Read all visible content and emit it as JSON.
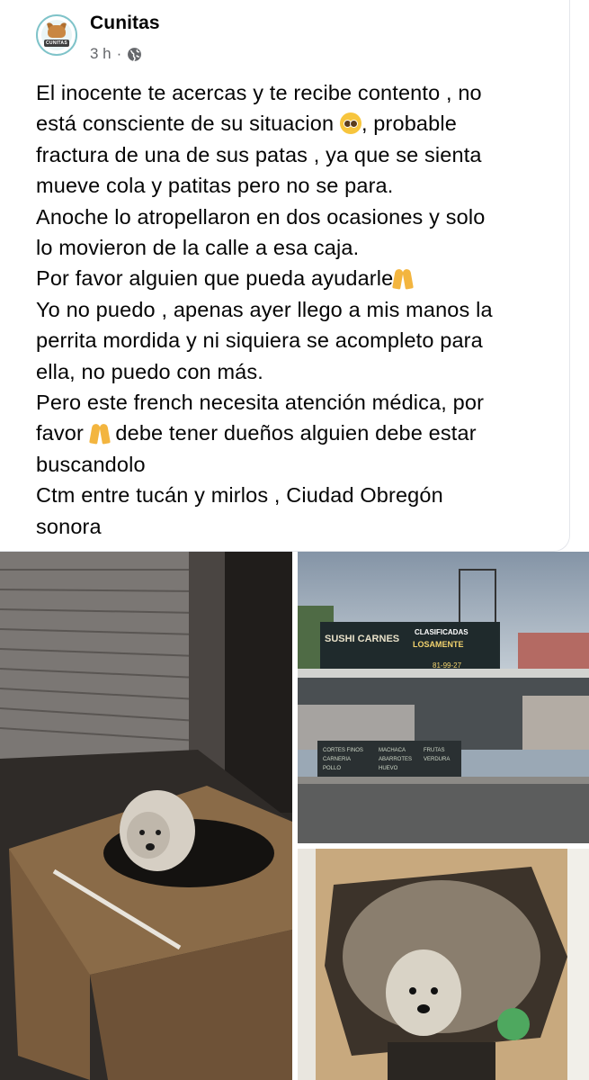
{
  "post": {
    "page_name": "Cunitas",
    "time": "3 h",
    "separator": "·",
    "avatar_text": "CUNITAS",
    "lines": [
      "El inocente te acercas y te recibe contento , no",
      "está consciente de su situacion",
      ", probable",
      "fractura de una de sus patas , ya que se sienta",
      "mueve cola y patitas pero no se para.",
      "Anoche lo atropellaron en dos ocasiones y solo",
      "lo movieron de la calle a esa caja.",
      "Por favor alguien que pueda ayudarle",
      "Yo no puedo , apenas ayer llego a mis manos la",
      "perrita mordida y ni siquiera se acompleto para",
      "ella, no puedo con más.",
      "Pero este french necesita atención médica, por",
      "favor",
      "debe tener dueños alguien debe estar",
      "buscandolo",
      "Ctm entre tucán y mirlos , Ciudad Obregón",
      "sonora"
    ],
    "icons": {
      "privacy": "globe-icon",
      "emoji_1": "pleading-face-icon",
      "emoji_2": "folded-hands-icon"
    }
  },
  "photos": {
    "photo_1_sign": "",
    "photo_2_sign_line1": "SUSHI  CARNES",
    "photo_2_sign_line2": "CLASIFICADAS",
    "photo_2_sign_line3": "LOSAMENTE",
    "photo_2_sign_line4": "81-99-27",
    "photo_2_menu": [
      "CORTES FINOS",
      "MACHACA",
      "FRUTAS",
      "CARNERIA",
      "ABARROTES",
      "VERDURA",
      "POLLO",
      "HUEVO"
    ]
  }
}
